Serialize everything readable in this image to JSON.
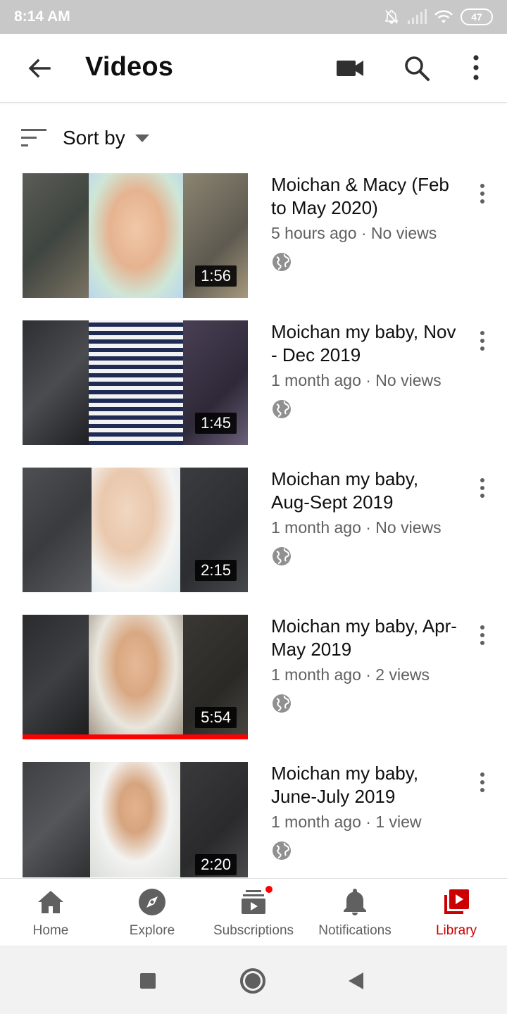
{
  "status_bar": {
    "time": "8:14 AM",
    "battery": "47",
    "icons": [
      "bell-off-icon",
      "signal-icon",
      "wifi-icon",
      "battery-icon"
    ]
  },
  "header": {
    "title": "Videos",
    "icons": [
      "back-arrow-icon",
      "video-camera-icon",
      "search-icon",
      "more-vert-icon"
    ]
  },
  "sort": {
    "label": "Sort by"
  },
  "videos": [
    {
      "title": "Moichan & Macy (Feb to May 2020)",
      "meta": "5 hours ago · No views",
      "duration": "1:56",
      "visibility_icon": "globe-icon",
      "watched_fraction": 0
    },
    {
      "title": "Moichan my baby, Nov - Dec 2019",
      "meta": "1 month ago · No views",
      "duration": "1:45",
      "visibility_icon": "globe-icon",
      "watched_fraction": 0
    },
    {
      "title": "Moichan my baby, Aug-Sept 2019",
      "meta": "1 month ago · No views",
      "duration": "2:15",
      "visibility_icon": "globe-icon",
      "watched_fraction": 0
    },
    {
      "title": "Moichan my baby, Apr-May 2019",
      "meta": "1 month ago · 2 views",
      "duration": "5:54",
      "visibility_icon": "globe-icon",
      "watched_fraction": 1
    },
    {
      "title": "Moichan my baby, June-July 2019",
      "meta": "1 month ago · 1 view",
      "duration": "2:20",
      "visibility_icon": "globe-icon",
      "watched_fraction": 0
    }
  ],
  "bottom_nav": [
    {
      "label": "Home",
      "icon": "home-icon",
      "active": false
    },
    {
      "label": "Explore",
      "icon": "compass-icon",
      "active": false
    },
    {
      "label": "Subscriptions",
      "icon": "subscriptions-icon",
      "active": false,
      "badge": true
    },
    {
      "label": "Notifications",
      "icon": "bell-icon",
      "active": false
    },
    {
      "label": "Library",
      "icon": "library-icon",
      "active": true
    }
  ],
  "colors": {
    "accent": "#cc0000",
    "progress": "#ff0000",
    "status_bar": "#c8c8c8",
    "secondary_text": "#606060"
  }
}
